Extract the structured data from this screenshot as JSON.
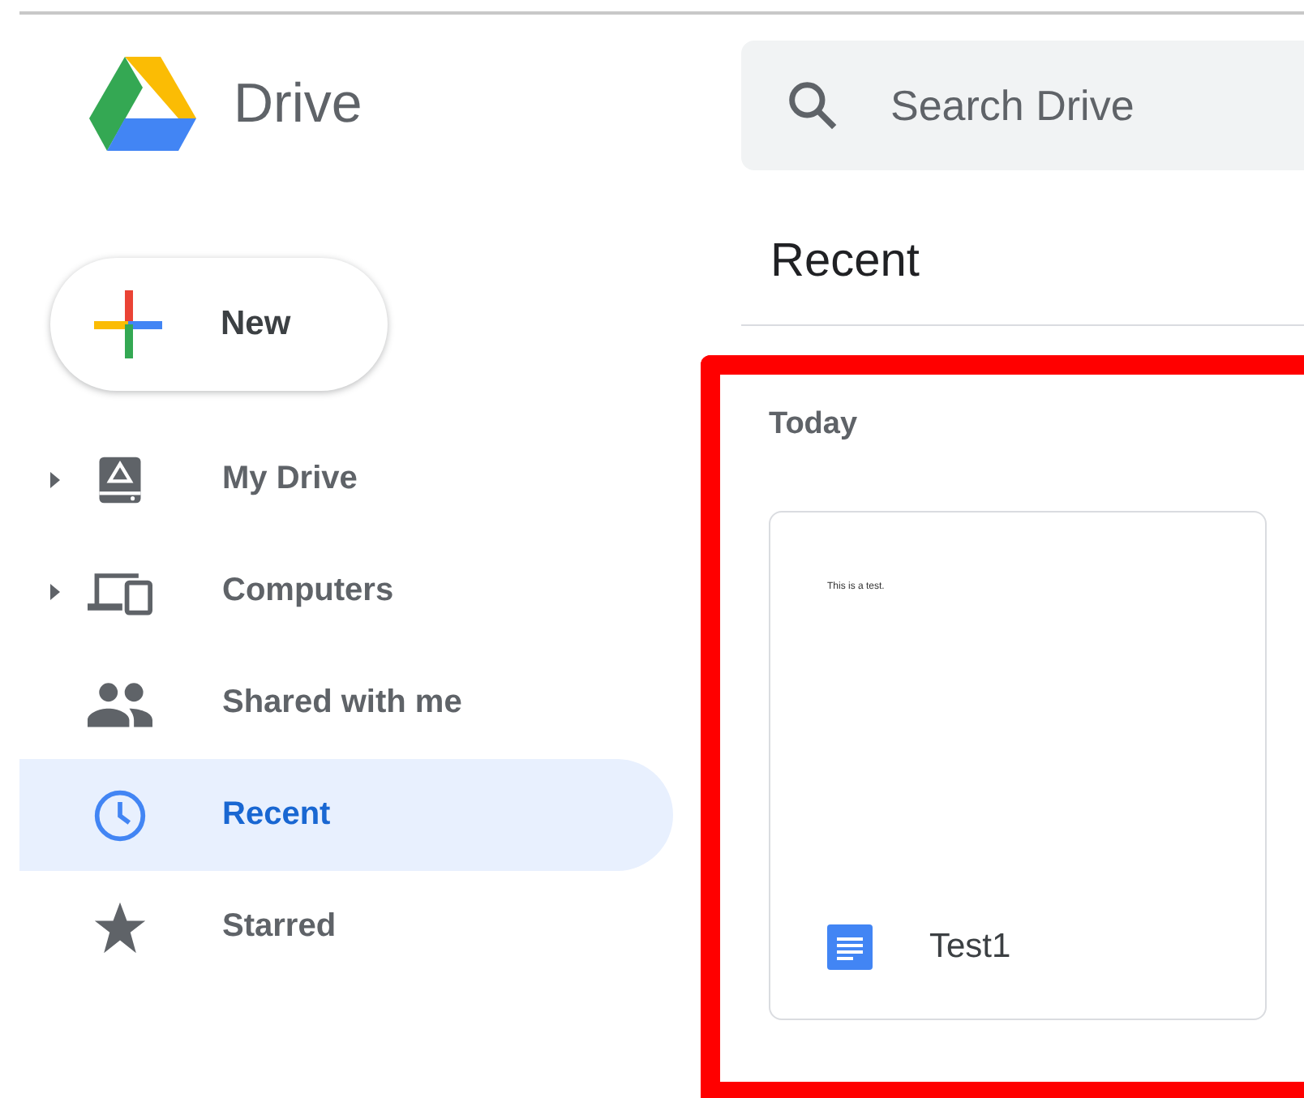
{
  "app": {
    "title": "Drive"
  },
  "new_button": {
    "label": "New"
  },
  "sidebar": {
    "items": [
      {
        "label": "My Drive",
        "expandable": true,
        "selected": false
      },
      {
        "label": "Computers",
        "expandable": true,
        "selected": false
      },
      {
        "label": "Shared with me",
        "expandable": false,
        "selected": false
      },
      {
        "label": "Recent",
        "expandable": false,
        "selected": true
      },
      {
        "label": "Starred",
        "expandable": false,
        "selected": false
      }
    ]
  },
  "search": {
    "placeholder": "Search Drive"
  },
  "page_title": "Recent",
  "section": {
    "title": "Today",
    "files": [
      {
        "name": "Test1",
        "preview": "This is a test."
      }
    ]
  }
}
